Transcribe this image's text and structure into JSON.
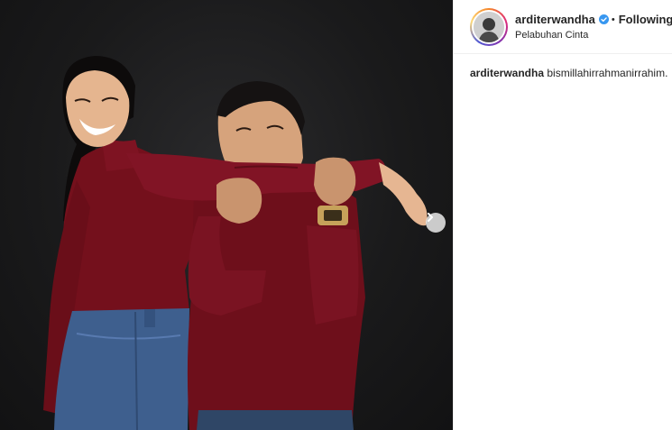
{
  "post": {
    "header": {
      "username": "arditerwandha",
      "separator": "•",
      "follow_status": "Following",
      "location": "Pelabuhan Cinta"
    },
    "caption": {
      "username": "arditerwandha",
      "text": "bismillahirrahmanirrahim."
    },
    "media": {
      "description_icon": "carousel-next-icon"
    }
  },
  "colors": {
    "verified_badge": "#3897f0",
    "sweater": "#7a1020",
    "jeans": "#3d5f8f",
    "background": "#1a1a1b"
  }
}
